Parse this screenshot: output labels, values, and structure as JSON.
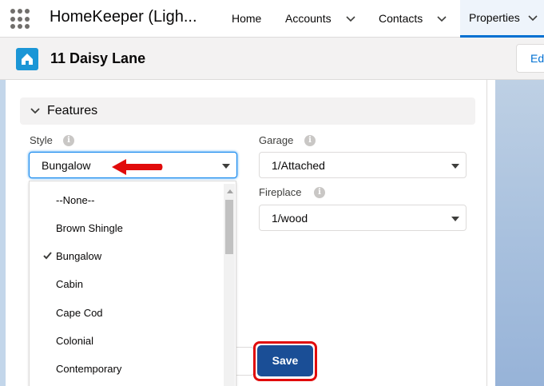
{
  "nav": {
    "app_name": "HomeKeeper (Ligh...",
    "items": [
      {
        "label": "Home"
      },
      {
        "label": "Accounts"
      },
      {
        "label": "Contacts"
      },
      {
        "label": "Properties"
      }
    ],
    "active_item": "Properties"
  },
  "record": {
    "title": "11 Daisy Lane",
    "edit_label": "Edit",
    "icon": "home-icon"
  },
  "section": {
    "title": "Features",
    "icon": "chevron-down-icon"
  },
  "fields": {
    "style": {
      "label": "Style",
      "value": "Bungalow"
    },
    "garage": {
      "label": "Garage",
      "value": "1/Attached"
    },
    "fireplace": {
      "label": "Fireplace",
      "value": "1/wood"
    }
  },
  "dropdown": {
    "options": [
      "--None--",
      "Brown Shingle",
      "Bungalow",
      "Cabin",
      "Cape Cod",
      "Colonial",
      "Contemporary"
    ],
    "selected": "Bungalow"
  },
  "footer": {
    "save_label": "Save"
  },
  "colors": {
    "brand_blue": "#0070d2",
    "save_button": "#1a4e96",
    "annotation_red": "#e10b0b",
    "record_icon": "#1b96d6"
  }
}
